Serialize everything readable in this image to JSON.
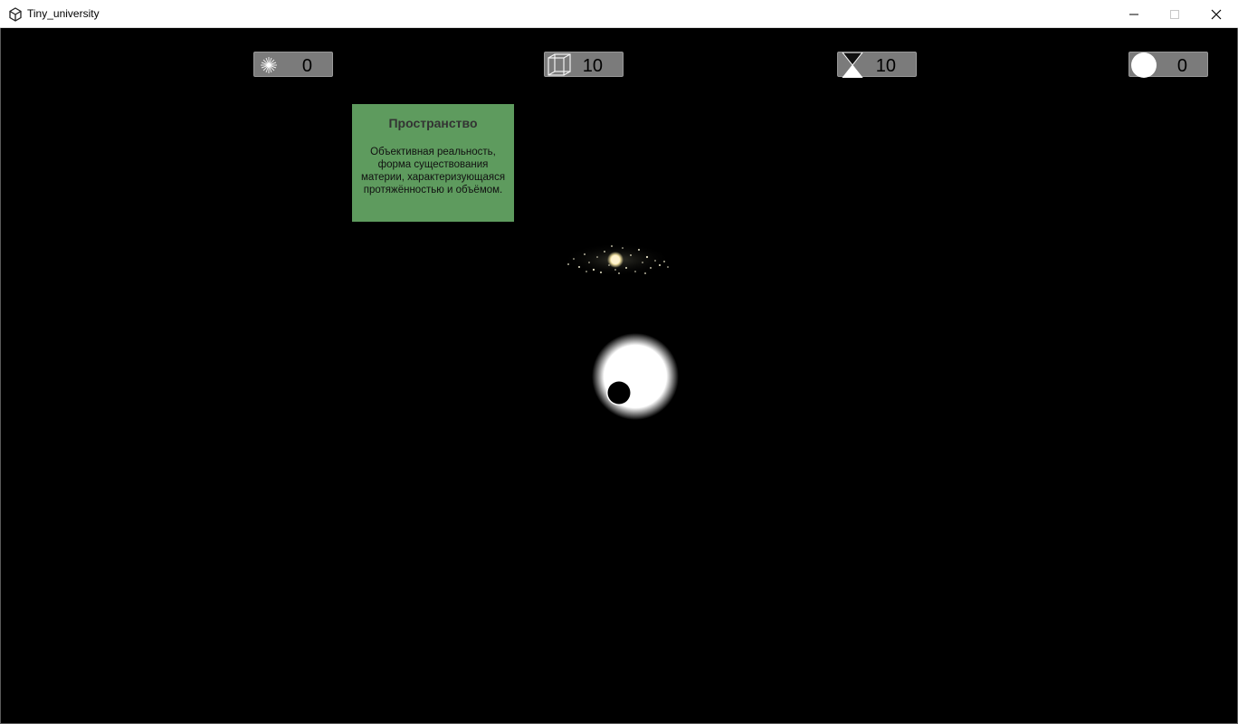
{
  "window": {
    "title": "Tiny_university",
    "icon": "unity-icon",
    "controls": [
      "minimize-icon",
      "maximize-icon",
      "close-icon"
    ]
  },
  "hud": {
    "energy": {
      "icon": "starburst-icon",
      "value": "0"
    },
    "space": {
      "icon": "cube-icon",
      "value": "10"
    },
    "time": {
      "icon": "hourglass-icon",
      "value": "10"
    },
    "matter": {
      "icon": "circle-icon",
      "value": "0"
    }
  },
  "info_card": {
    "title": "Пространство",
    "description": "Объективная реальность, форма существования материи, характеризующаяся протяжённостью и объёмом."
  },
  "scene": {
    "objects": [
      "galaxy",
      "glowing-orb"
    ]
  },
  "colors": {
    "background": "#000000",
    "counter_bg": "#7b7b7b",
    "card_bg": "#5e9b5e"
  }
}
